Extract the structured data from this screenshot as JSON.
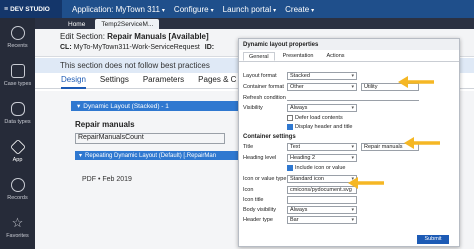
{
  "topbar": {
    "brand": "DEV STUDIO",
    "menu": [
      {
        "label": "Application: MyTown 311",
        "caret": "▾"
      },
      {
        "label": "Configure",
        "caret": "▾"
      },
      {
        "label": "Launch portal",
        "caret": "▾"
      },
      {
        "label": "Create",
        "caret": "▾"
      }
    ]
  },
  "sidebar": {
    "items": [
      {
        "label": "Recents",
        "icon": "clock-icon"
      },
      {
        "label": "Case types",
        "icon": "briefcase-icon"
      },
      {
        "label": "Data types",
        "icon": "database-icon"
      },
      {
        "label": "App",
        "icon": "app-icon"
      },
      {
        "label": "Records",
        "icon": "records-icon"
      },
      {
        "label": "Favorites",
        "icon": "star-icon"
      }
    ]
  },
  "app_tabs": {
    "home": "Home",
    "active": "Temp2ServiceM..."
  },
  "rule_header": {
    "title_label": "Edit  Section:",
    "title_value": "Repair Manuals [Available]",
    "class_label": "CL:",
    "class_value": "MyTo-MyTown311-Work-ServiceRequest",
    "id_label": "ID:"
  },
  "notice": "This section does not follow best practices",
  "rule_tabs": [
    "Design",
    "Settings",
    "Parameters",
    "Pages & C"
  ],
  "canvas": {
    "dynamic_layout": "Dynamic Layout (Stacked) - 1",
    "section_title": "Repair manuals",
    "count_field": "RepairManualsCount",
    "repeating_layout": "Repeating Dynamic Layout (Default) [.RepairMan",
    "pdf_line": "PDF • Feb 2019"
  },
  "dialog": {
    "title": "Dynamic layout properties",
    "tabs": [
      "General",
      "Presentation",
      "Actions"
    ],
    "layout_format_label": "Layout format",
    "layout_format_value": "Stacked",
    "container_format_label": "Container format",
    "container_format_value": "Other",
    "container_format_text": "Utility",
    "refresh_condition_label": "Refresh condition",
    "visibility_label": "Visibility",
    "visibility_value": "Always",
    "defer_load": "Defer load contents",
    "display_header": "Display header and title",
    "container_settings_header": "Container settings",
    "title_label": "Title",
    "title_select": "Text",
    "title_value": "Repair manuals",
    "heading_level_label": "Heading level",
    "heading_level_value": "Heading 2",
    "include_icon": "Include icon or value",
    "icon_or_value_label": "Icon or value type",
    "icon_or_value_value": "Standard icon",
    "icon_label": "Icon",
    "icon_value": "cmicons/pydocument.svg",
    "icon_title_label": "Icon title",
    "body_visibility_label": "Body visibility",
    "body_visibility_value": "Always",
    "header_type_label": "Header type",
    "header_type_value": "Bar",
    "submit": "Submit"
  },
  "colors": {
    "accent": "#1d5bb5",
    "arrow": "#f5b724",
    "topbar": "#1f4f8b"
  }
}
